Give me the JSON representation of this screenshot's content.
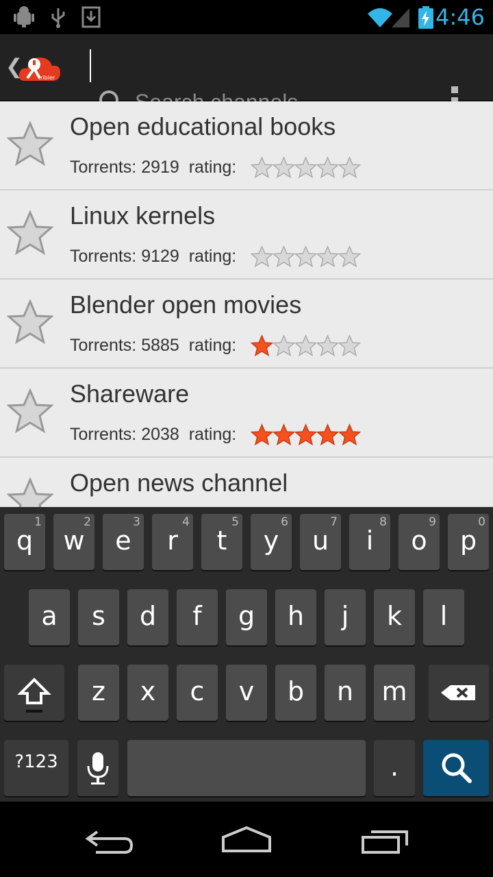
{
  "status_bar": {
    "time": "4:46"
  },
  "action_bar": {
    "search_placeholder": "Search channels"
  },
  "channels": [
    {
      "title": "Open educational books",
      "torrents_label": "Torrents: 2919",
      "rating_label": "rating:",
      "rating": 0
    },
    {
      "title": "Linux kernels",
      "torrents_label": "Torrents: 9129",
      "rating_label": "rating:",
      "rating": 0
    },
    {
      "title": "Blender open movies",
      "torrents_label": "Torrents: 5885",
      "rating_label": "rating:",
      "rating": 1
    },
    {
      "title": "Shareware",
      "torrents_label": "Torrents: 2038",
      "rating_label": "rating:",
      "rating": 5
    },
    {
      "title": "Open news channel"
    }
  ],
  "keyboard": {
    "row1": [
      {
        "k": "q",
        "n": "1"
      },
      {
        "k": "w",
        "n": "2"
      },
      {
        "k": "e",
        "n": "3"
      },
      {
        "k": "r",
        "n": "4"
      },
      {
        "k": "t",
        "n": "5"
      },
      {
        "k": "y",
        "n": "6"
      },
      {
        "k": "u",
        "n": "7"
      },
      {
        "k": "i",
        "n": "8"
      },
      {
        "k": "o",
        "n": "9"
      },
      {
        "k": "p",
        "n": "0"
      }
    ],
    "row2": [
      "a",
      "s",
      "d",
      "f",
      "g",
      "h",
      "j",
      "k",
      "l"
    ],
    "row3": [
      "z",
      "x",
      "c",
      "v",
      "b",
      "n",
      "m"
    ],
    "symbols_label": "?123",
    "period_label": "."
  },
  "colors": {
    "accent": "#33b5e5",
    "star_filled": "#f4511e",
    "star_empty": "#d8d8d8"
  }
}
